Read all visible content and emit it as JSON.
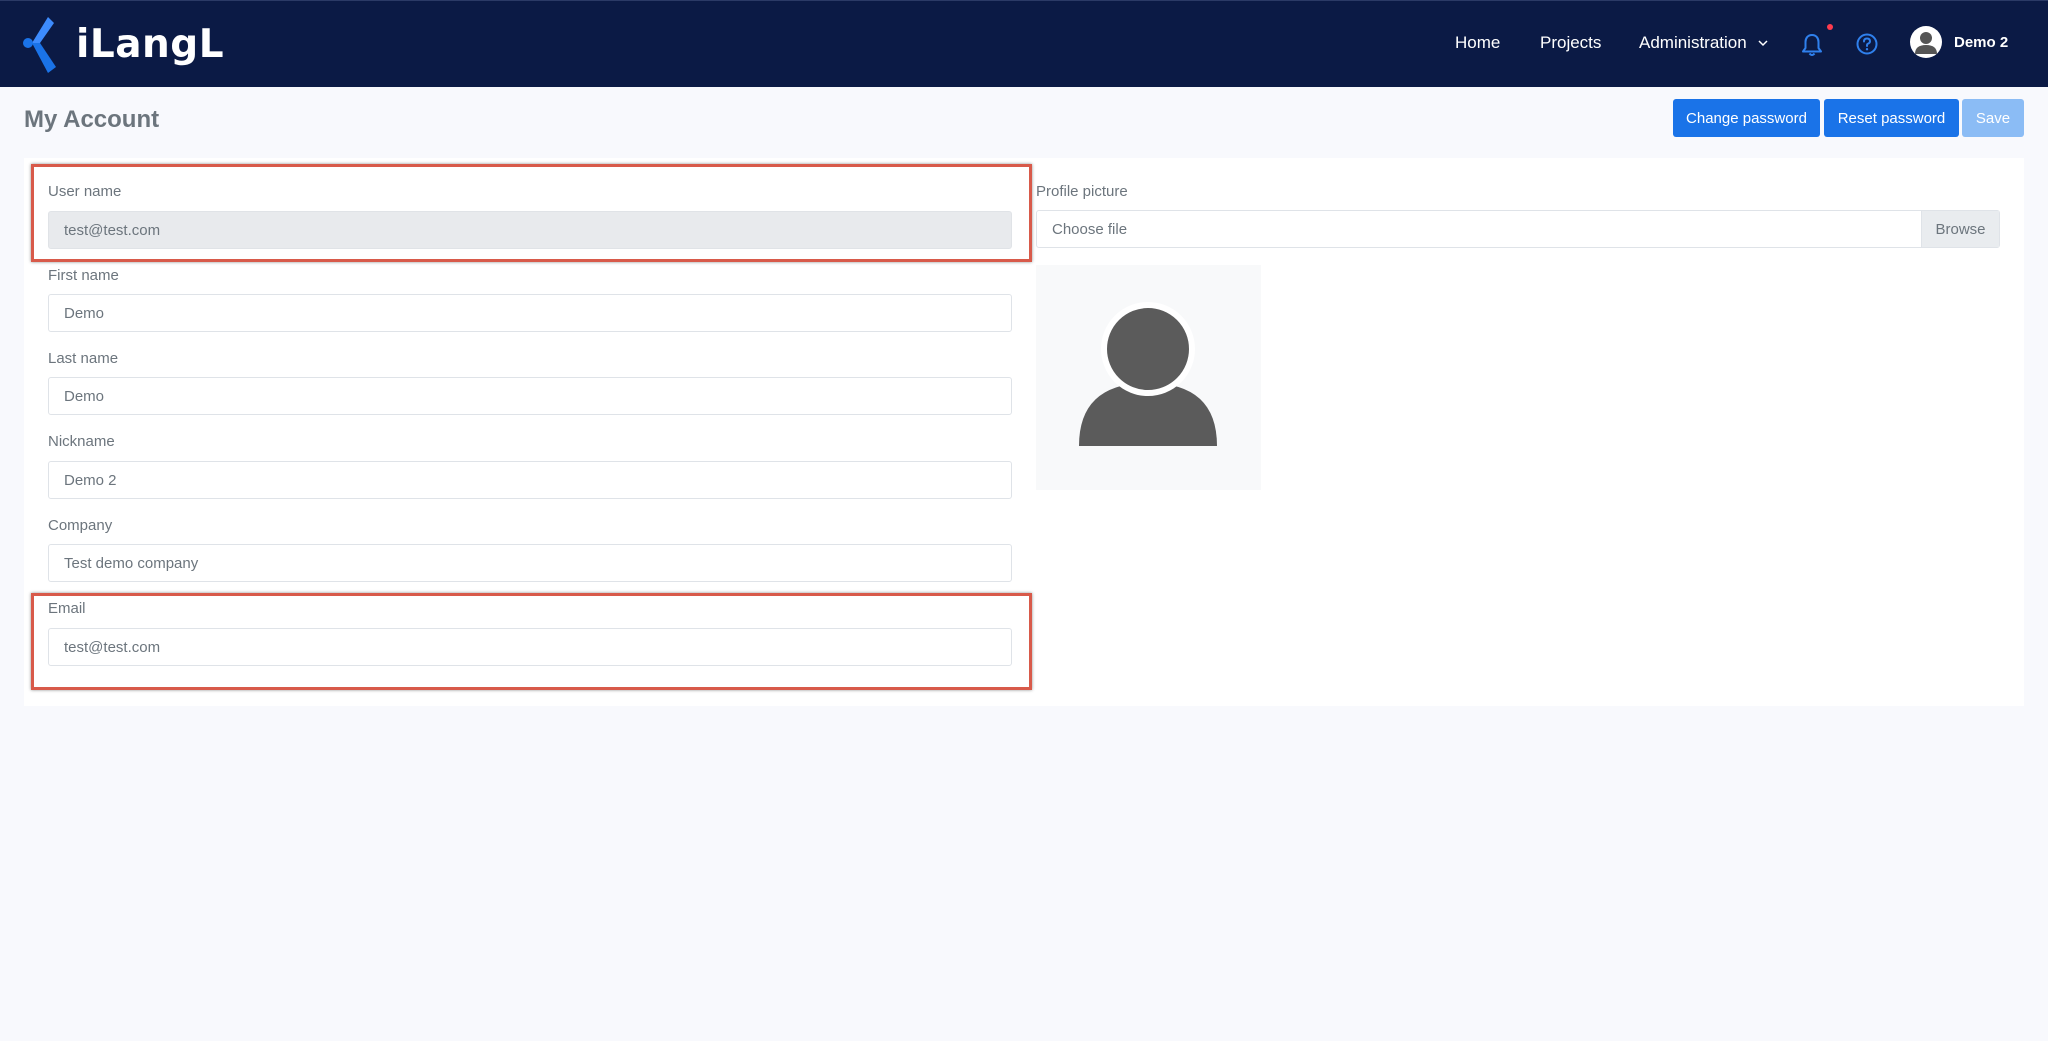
{
  "brand": {
    "name": "iLangL",
    "accent": "#1a73e8",
    "nav_bg": "#0b1a45"
  },
  "nav": {
    "home": "Home",
    "projects": "Projects",
    "administration": "Administration",
    "user": "Demo 2",
    "icons": [
      "bell-icon",
      "help-icon",
      "user-avatar-icon",
      "chevron-down-icon"
    ]
  },
  "page": {
    "title": "My Account",
    "buttons": {
      "change_password": "Change password",
      "reset_password": "Reset password",
      "save": "Save"
    }
  },
  "form": {
    "username": {
      "label": "User name",
      "value": "test@test.com",
      "disabled": true
    },
    "first_name": {
      "label": "First name",
      "value": "Demo"
    },
    "last_name": {
      "label": "Last name",
      "value": "Demo"
    },
    "nickname": {
      "label": "Nickname",
      "value": "Demo 2"
    },
    "company": {
      "label": "Company",
      "value": "Test demo company"
    },
    "email": {
      "label": "Email",
      "value": "test@test.com"
    }
  },
  "profile": {
    "label": "Profile picture",
    "choose_file": "Choose file",
    "browse": "Browse"
  }
}
